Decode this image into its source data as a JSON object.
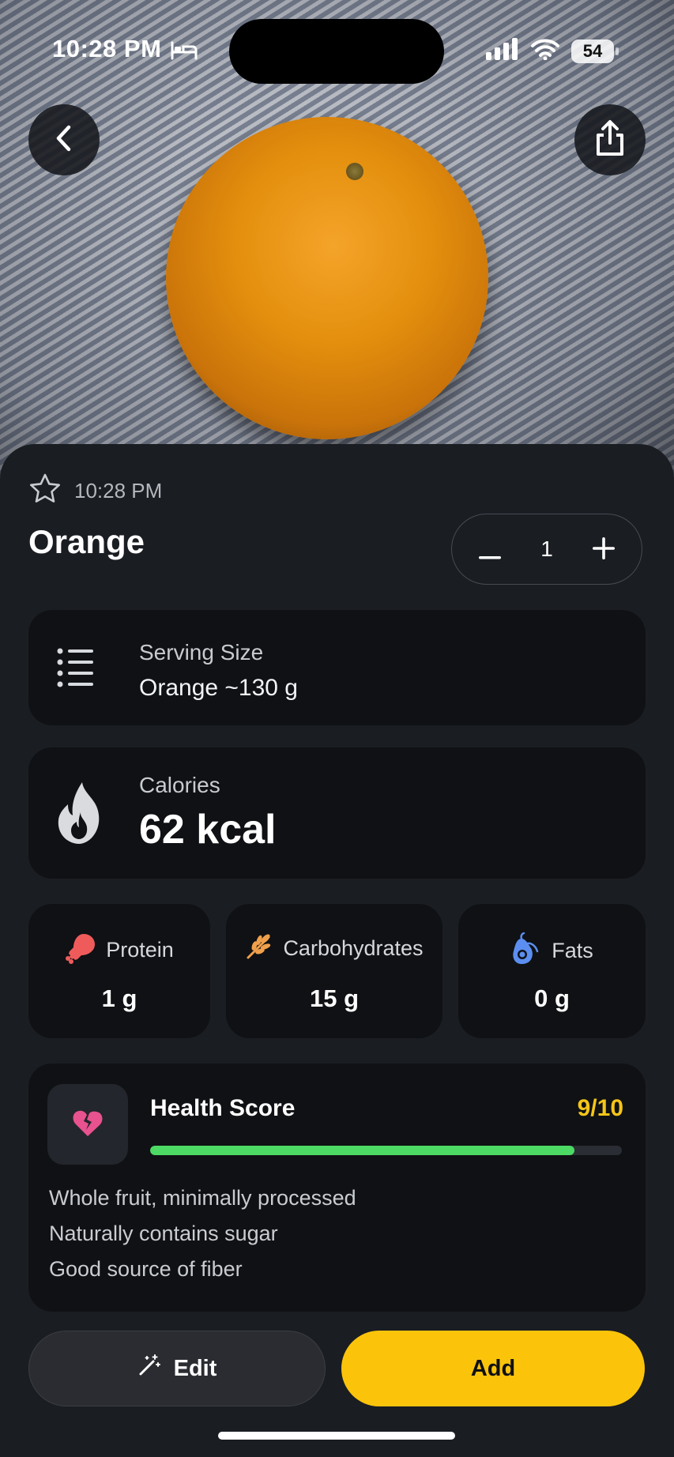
{
  "status_bar": {
    "time": "10:28 PM",
    "battery": "54"
  },
  "photo": {
    "subject": "orange"
  },
  "entry": {
    "time": "10:28 PM",
    "title": "Orange",
    "quantity": "1"
  },
  "serving": {
    "label": "Serving Size",
    "value": "Orange ~130 g"
  },
  "calories": {
    "label": "Calories",
    "value": "62 kcal"
  },
  "macros": [
    {
      "label": "Protein",
      "value": "1 g",
      "icon": "drumstick-icon",
      "color": "#ef5b5b"
    },
    {
      "label": "Carbohydrates",
      "value": "15 g",
      "icon": "wheat-icon",
      "color": "#f0a04b"
    },
    {
      "label": "Fats",
      "value": "0 g",
      "icon": "avocado-icon",
      "color": "#5b8ef0"
    }
  ],
  "health": {
    "title": "Health Score",
    "score": "9/10",
    "score_fraction": 0.9,
    "notes": [
      "Whole fruit, minimally processed",
      "Naturally contains sugar",
      "Good source of fiber"
    ]
  },
  "actions": {
    "edit": "Edit",
    "add": "Add"
  },
  "colors": {
    "accent": "#fbc40b",
    "progress": "#4cd964",
    "score": "#f5c518"
  }
}
